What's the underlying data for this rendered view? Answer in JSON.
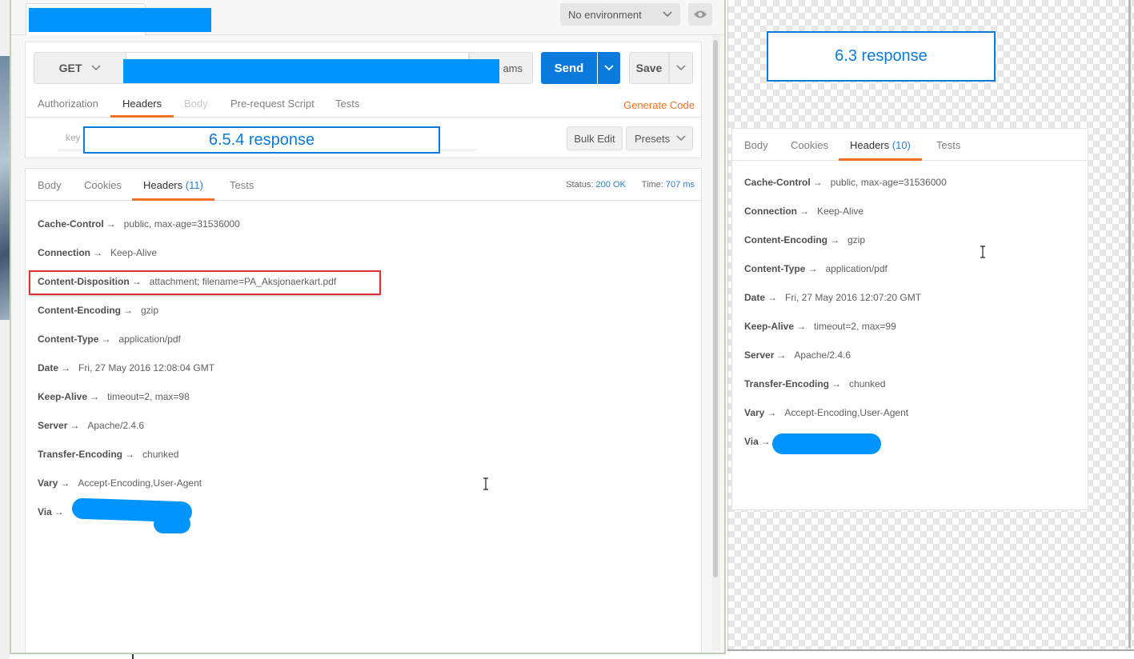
{
  "env_select": {
    "label": "No environment"
  },
  "request": {
    "method": "GET",
    "params_label": "ams",
    "send_label": "Send",
    "save_label": "Save",
    "tabs": [
      {
        "label": "Authorization",
        "state": "normal"
      },
      {
        "label": "Headers",
        "state": "active"
      },
      {
        "label": "Body",
        "state": "disabled"
      },
      {
        "label": "Pre-request Script",
        "state": "normal"
      },
      {
        "label": "Tests",
        "state": "normal"
      }
    ],
    "generate_code": "Generate Code",
    "key_placeholder": "key",
    "bulk_edit": "Bulk Edit",
    "presets": "Presets"
  },
  "annotations": {
    "left": "6.5.4 response",
    "right": "6.3 response"
  },
  "response": {
    "tabs": {
      "body": "Body",
      "cookies": "Cookies",
      "headers": "Headers",
      "headers_count": "(11)",
      "tests": "Tests"
    },
    "status_label": "Status:",
    "status_value": "200 OK",
    "time_label": "Time:",
    "time_value": "707 ms",
    "headers": [
      {
        "key": "Cache-Control",
        "value": "public, max-age=31536000"
      },
      {
        "key": "Connection",
        "value": "Keep-Alive"
      },
      {
        "key": "Content-Disposition",
        "value": "attachment; filename=PA_Aksjonaerkart.pdf"
      },
      {
        "key": "Content-Encoding",
        "value": "gzip"
      },
      {
        "key": "Content-Type",
        "value": "application/pdf"
      },
      {
        "key": "Date",
        "value": "Fri, 27 May 2016 12:08:04 GMT"
      },
      {
        "key": "Keep-Alive",
        "value": "timeout=2, max=98"
      },
      {
        "key": "Server",
        "value": "Apache/2.4.6"
      },
      {
        "key": "Transfer-Encoding",
        "value": "chunked"
      },
      {
        "key": "Vary",
        "value": "Accept-Encoding,User-Agent"
      },
      {
        "key": "Via",
        "value": ""
      }
    ]
  },
  "right_response": {
    "tabs": {
      "body": "Body",
      "cookies": "Cookies",
      "headers": "Headers",
      "headers_count": "(10)",
      "tests": "Tests"
    },
    "headers": [
      {
        "key": "Cache-Control",
        "value": "public, max-age=31536000"
      },
      {
        "key": "Connection",
        "value": "Keep-Alive"
      },
      {
        "key": "Content-Encoding",
        "value": "gzip"
      },
      {
        "key": "Content-Type",
        "value": "application/pdf"
      },
      {
        "key": "Date",
        "value": "Fri, 27 May 2016 12:07:20 GMT"
      },
      {
        "key": "Keep-Alive",
        "value": "timeout=2, max=99"
      },
      {
        "key": "Server",
        "value": "Apache/2.4.6"
      },
      {
        "key": "Transfer-Encoding",
        "value": "chunked"
      },
      {
        "key": "Vary",
        "value": "Accept-Encoding,User-Agent"
      },
      {
        "key": "Via",
        "value": ""
      }
    ]
  },
  "arrow_glyph": "→",
  "colors": {
    "accent_orange": "#f47023",
    "send_blue": "#0a7bdc",
    "redaction_blue": "#0094ff",
    "highlight_red": "#e03030"
  }
}
